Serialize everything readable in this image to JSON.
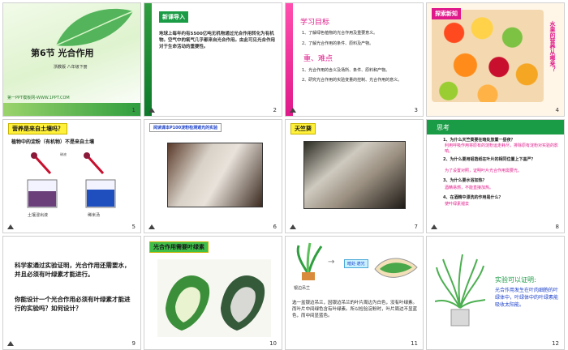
{
  "colors": {
    "green": "#1a9b45",
    "pink": "#e0198a",
    "yellow": "#fff03a",
    "blue": "#1a3fc9"
  },
  "slides": [
    {
      "num": "1",
      "title": "第6节 光合作用",
      "subtitle": "浙教版 八年级下册",
      "footer": "第一PPT模板网-WWW.1PPT.COM"
    },
    {
      "num": "2",
      "tag": "新课导入",
      "body": "       地球上每年约有5500亿吨无机物通过光合作用转化为有机物。空气中的氧气几乎都来自光合作用。由此可见光合作用对于生命活动的重要性。"
    },
    {
      "num": "3",
      "title": "学习目标",
      "items": [
        "1、了解绿色植物的光合作用及重要意义。",
        "2、了解光合作用的条件、原料及产物。"
      ],
      "heading2": "重、难点",
      "items2": [
        "1、光合作用的含义及场所、条件、原料和产物。",
        "2、研究光合作用的实验变量的控制、光合作用的意义。"
      ]
    },
    {
      "num": "4",
      "tag": "探索新知",
      "vertical": "水果的营养从哪来？"
    },
    {
      "num": "5",
      "tag": "营养是来自土壤吗？",
      "question": "植物中的淀粉（有机物）不是来自土壤",
      "label_drop": "碘液",
      "label_left": "土壤浸出液",
      "label_right": "稀米汤"
    },
    {
      "num": "6",
      "tag": "阅读课本P100淀粉检测遮光的实验"
    },
    {
      "num": "7",
      "tag": "天竺葵"
    },
    {
      "num": "8",
      "title": "思考",
      "items": [
        {
          "q": "1、为什么天竺葵要在暗处放置一昼夜？",
          "a": "利用呼吸作用将原有的淀粉运走耗尽，排除原有淀粉对实验的影响。"
        },
        {
          "q": "2、为什么要用铝箔纸在叶片的相同位置上下盖严？",
          "a": "为了设置对照，证明叶片光合作用需要光。"
        },
        {
          "q": "3、为什么要水浴加热？",
          "a": "酒精易燃，不能直接加热。"
        },
        {
          "q": "4、在酒精中漂洗的作用是什么？",
          "a": "使叶绿素褪去"
        }
      ]
    },
    {
      "num": "9",
      "body": "科学家通过实验证明，光合作用还需要水，并且必须有叶绿素才能进行。",
      "body2": "你能设计一个光合作用必须有叶绿素才能进行的实验吗？如何设计？"
    },
    {
      "num": "10",
      "tag": "光合作用需要叶绿素"
    },
    {
      "num": "11",
      "label_plant": "银边吊兰",
      "label_box": "暗处·遮光",
      "body": "选一盆银边吊兰，因银边吊兰的叶片周边为白色，没有叶绿素。而叶片中间绿色含有叶绿素。所以检验淀粉时，叶片周边不显蓝色，而中间显蓝色。"
    },
    {
      "num": "12",
      "tag": "实验可以证明:",
      "body": "光合作用发生在叶肉细胞的叶绿体中，叶绿体中的叶绿素能吸收太阳能。"
    }
  ]
}
